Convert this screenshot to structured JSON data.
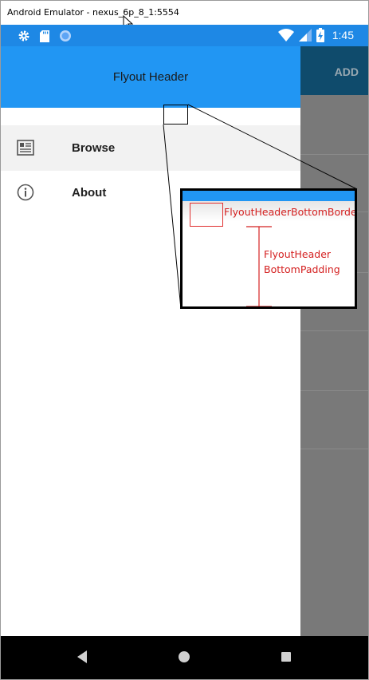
{
  "window": {
    "title": "Android Emulator - nexus_6p_8_1:5554"
  },
  "status_bar": {
    "time": "1:45",
    "color": "#1e88e5"
  },
  "app": {
    "toolbar_action": "ADD",
    "toolbar_color": "#0f4b6c"
  },
  "flyout": {
    "header_title": "Flyout Header",
    "header_color": "#2196f3",
    "items": [
      {
        "label": "Browse",
        "icon": "browse-icon",
        "selected": true
      },
      {
        "label": "About",
        "icon": "info-icon",
        "selected": false
      }
    ]
  },
  "annotation": {
    "border_label": "FlyoutHeaderBottomBorder",
    "padding_label_line1": "FlyoutHeader",
    "padding_label_line2": "BottomPadding",
    "color": "#d42020"
  }
}
